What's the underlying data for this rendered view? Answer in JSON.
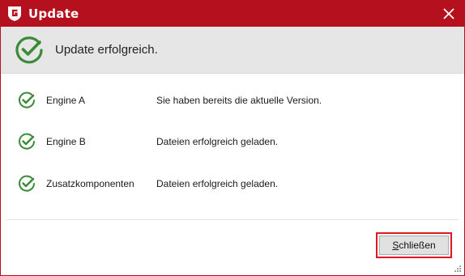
{
  "window": {
    "title": "Update",
    "accent": "#b5101d"
  },
  "banner": {
    "message": "Update erfolgreich.",
    "icon": "success-check-icon",
    "check_color": "#3a8a3a"
  },
  "components": [
    {
      "name": "Engine A",
      "status": "Sie haben bereits die aktuelle Version.",
      "icon": "success-check-icon"
    },
    {
      "name": "Engine B",
      "status": "Dateien erfolgreich geladen.",
      "icon": "success-check-icon"
    },
    {
      "name": "Zusatzkomponenten",
      "status": "Dateien erfolgreich geladen.",
      "icon": "success-check-icon"
    }
  ],
  "footer": {
    "close_button_mnemonic": "S",
    "close_button_rest": "chließen",
    "highlight_color": "#e01722"
  }
}
